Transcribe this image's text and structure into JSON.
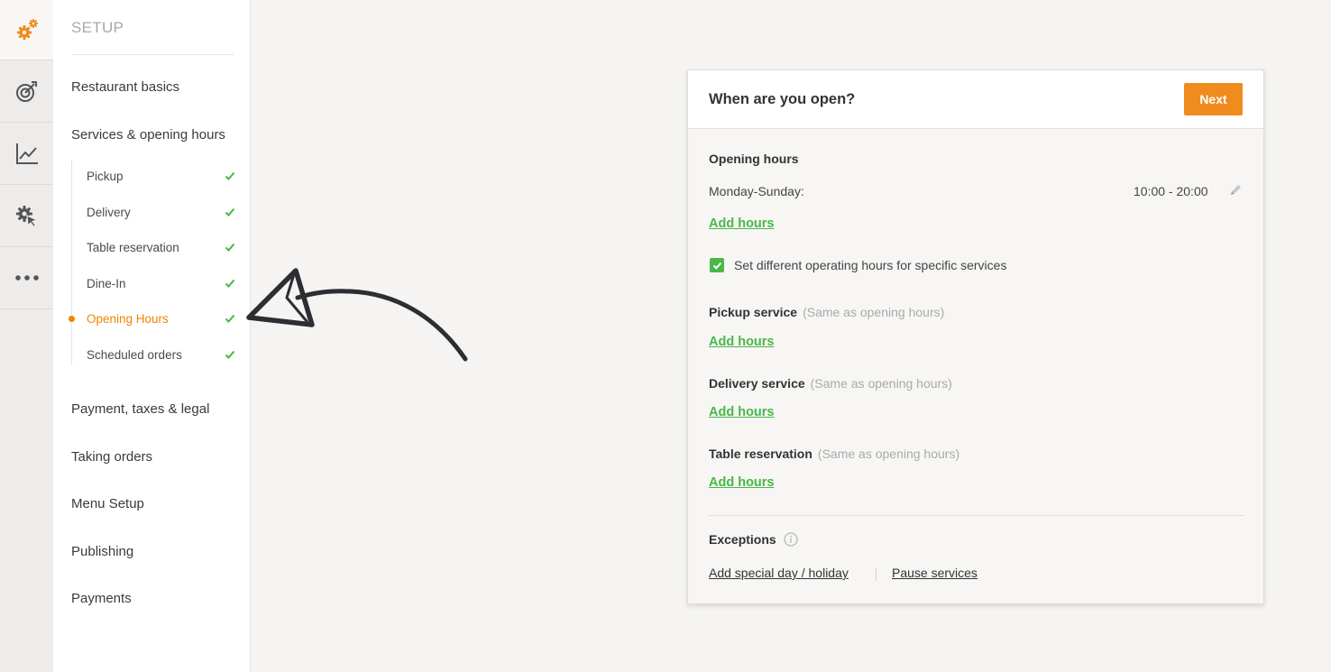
{
  "sidebar": {
    "title": "SETUP",
    "items": [
      {
        "label": "Restaurant basics"
      },
      {
        "label": "Services & opening hours"
      },
      {
        "label": "Payment, taxes & legal"
      },
      {
        "label": "Taking orders"
      },
      {
        "label": "Menu Setup"
      },
      {
        "label": "Publishing"
      },
      {
        "label": "Payments"
      }
    ],
    "subitems": [
      {
        "label": "Pickup",
        "done": true
      },
      {
        "label": "Delivery",
        "done": true
      },
      {
        "label": "Table reservation",
        "done": true
      },
      {
        "label": "Dine-In",
        "done": true
      },
      {
        "label": "Opening Hours",
        "done": true,
        "active": true
      },
      {
        "label": "Scheduled orders",
        "done": true
      }
    ]
  },
  "rail": {
    "icons": [
      "setup-gears-icon",
      "target-icon",
      "chart-icon",
      "marketing-gear-icon",
      "more-icon"
    ]
  },
  "colors": {
    "accent": "#f08b1e",
    "active_text": "#f08400",
    "success": "#49b749"
  },
  "card": {
    "title": "When are you open?",
    "next_label": "Next",
    "opening_hours": {
      "label": "Opening hours",
      "days": "Monday-Sunday:",
      "time": "10:00 - 20:00",
      "add_label": "Add hours"
    },
    "different_hours": {
      "checked": true,
      "label": "Set different operating hours for specific services"
    },
    "services": [
      {
        "label": "Pickup service",
        "note": "(Same as opening hours)",
        "add_label": "Add hours"
      },
      {
        "label": "Delivery service",
        "note": "(Same as opening hours)",
        "add_label": "Add hours"
      },
      {
        "label": "Table reservation",
        "note": "(Same as opening hours)",
        "add_label": "Add hours"
      }
    ],
    "exceptions": {
      "label": "Exceptions",
      "special_day_label": "Add special day / holiday",
      "pause_label": "Pause services"
    }
  }
}
